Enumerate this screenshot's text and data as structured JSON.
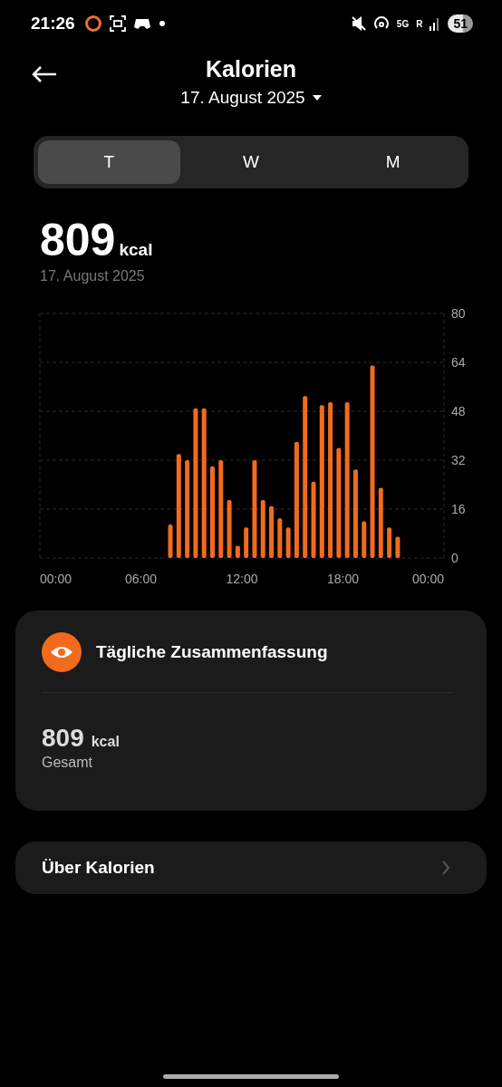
{
  "status_bar": {
    "time": "21:26",
    "network": "5G",
    "roaming": "R",
    "battery": "51"
  },
  "header": {
    "title": "Kalorien",
    "date": "17. August 2025"
  },
  "tabs": [
    {
      "label": "T",
      "selected": true
    },
    {
      "label": "W",
      "selected": false
    },
    {
      "label": "M",
      "selected": false
    }
  ],
  "summary": {
    "value": "809",
    "unit": "kcal",
    "date": "17. August 2025"
  },
  "chart": {
    "chart_data": {
      "type": "bar",
      "x": [
        7.75,
        8.25,
        8.75,
        9.25,
        9.75,
        10.25,
        10.75,
        11.25,
        11.75,
        12.25,
        12.75,
        13.25,
        13.75,
        14.25,
        14.75,
        15.25,
        15.75,
        16.25,
        16.75,
        17.25,
        17.75,
        18.25,
        18.75,
        19.25,
        19.75,
        20.25,
        20.75,
        21.25
      ],
      "grid": true,
      "series": [
        {
          "color": "#f26b1d",
          "values": [
            11,
            34,
            32,
            49,
            49,
            30,
            32,
            19,
            4,
            10,
            32,
            19,
            17,
            13,
            10,
            38,
            53,
            25,
            50,
            51,
            36,
            51,
            29,
            12,
            63,
            23,
            10,
            7
          ]
        }
      ],
      "xlim": [
        0,
        24
      ],
      "ylim": [
        0,
        80
      ],
      "xticks": [
        {
          "value": 0,
          "label": "00:00"
        },
        {
          "value": 6,
          "label": "06:00"
        },
        {
          "value": 12,
          "label": "12:00"
        },
        {
          "value": 18,
          "label": "18:00"
        },
        {
          "value": 24,
          "label": "00:00"
        }
      ],
      "yticks": [
        0,
        16,
        32,
        48,
        64,
        80
      ]
    }
  },
  "daily_card": {
    "title": "Tägliche Zusammenfassung",
    "value": "809",
    "unit": "kcal",
    "label": "Gesamt"
  },
  "about_row": {
    "label": "Über Kalorien"
  }
}
